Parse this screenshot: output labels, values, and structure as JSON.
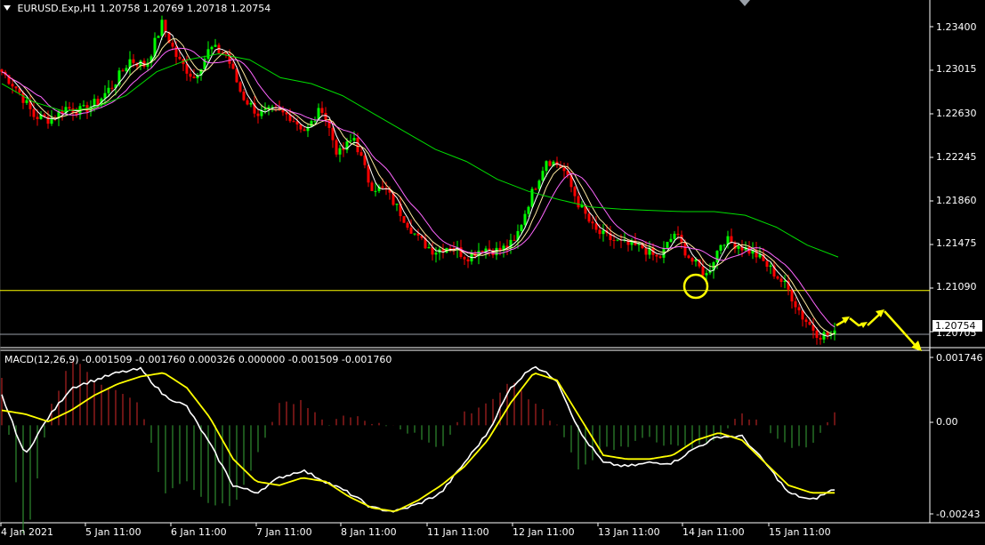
{
  "window": {
    "symbol_label": "EURUSD.Exp,H1",
    "ohlc_label": "1.20758 1.20769 1.20718 1.20754"
  },
  "price_axis": {
    "ticks": [
      "1.23400",
      "1.23015",
      "1.22630",
      "1.22245",
      "1.21860",
      "1.21475",
      "1.21090",
      "1.20705"
    ],
    "current_price": "1.20754"
  },
  "macd": {
    "label": "MACD(12,26,9) -0.001509 -0.001760 0.000326 0.000000 -0.001509 -0.001760",
    "ticks": [
      "0.001746",
      "0.00",
      "-0.00243"
    ]
  },
  "time_axis": {
    "ticks": [
      "4 Jan 2021",
      "5 Jan 11:00",
      "6 Jan 11:00",
      "7 Jan 11:00",
      "8 Jan 11:00",
      "11 Jan 11:00",
      "12 Jan 11:00",
      "13 Jan 11:00",
      "14 Jan 11:00",
      "15 Jan 11:00"
    ]
  },
  "colors": {
    "background": "#000000",
    "bull": "#00ff00",
    "bear": "#ff0000",
    "ma_fast": "#ffffff",
    "ma_mid": "#ffe9a0",
    "ma_purple": "#ff66ff",
    "ma_slow": "#00dd00",
    "hline": "#ffff00",
    "macd_main": "#ffffff",
    "macd_signal": "#ffff00",
    "hist_pos": "#b22222",
    "hist_neg": "#2e8b2e",
    "annotation": "#ffff00"
  },
  "chart_data": [
    {
      "type": "candlestick",
      "title": "EURUSD.Exp,H1",
      "ylim": [
        1.2065,
        1.2355
      ],
      "x": [
        "4 Jan 2021",
        "5 Jan 11:00",
        "6 Jan 11:00",
        "7 Jan 11:00",
        "8 Jan 11:00",
        "11 Jan 11:00",
        "12 Jan 11:00",
        "13 Jan 11:00",
        "14 Jan 11:00",
        "15 Jan 11:00"
      ],
      "close_path": [
        1.2295,
        1.228,
        1.2258,
        1.2255,
        1.2265,
        1.2262,
        1.227,
        1.2285,
        1.2305,
        1.23,
        1.2335,
        1.2305,
        1.229,
        1.2315,
        1.231,
        1.2275,
        1.226,
        1.2262,
        1.2258,
        1.2245,
        1.2265,
        1.2225,
        1.224,
        1.22,
        1.2195,
        1.2175,
        1.2155,
        1.2145,
        1.215,
        1.214,
        1.2148,
        1.2145,
        1.2152,
        1.219,
        1.2222,
        1.2215,
        1.2185,
        1.2162,
        1.2155,
        1.215,
        1.2148,
        1.2138,
        1.216,
        1.2138,
        1.2125,
        1.2155,
        1.215,
        1.2143,
        1.213,
        1.2115,
        1.209,
        1.2075,
        1.2075
      ],
      "horizontal_lines": [
        1.2112,
        1.20754
      ],
      "series": [
        {
          "values": [
            1.2285,
            1.227,
            1.2262,
            1.2265,
            1.2275,
            1.2295,
            1.2305,
            1.231,
            1.2305,
            1.229,
            1.2285,
            1.2275,
            1.226,
            1.2245,
            1.223,
            1.222,
            1.2205,
            1.2195,
            1.2188,
            1.2182,
            1.218,
            1.2179,
            1.2178,
            1.2178,
            1.2175,
            1.2165,
            1.215,
            1.214
          ]
        }
      ]
    },
    {
      "type": "bar",
      "title": "MACD(12,26,9)",
      "ylim": [
        -0.0026,
        0.002
      ],
      "main": [
        0.0008,
        -0.0008,
        0.0002,
        0.001,
        0.0012,
        0.0014,
        0.0015,
        0.0008,
        0.0005,
        -0.0005,
        -0.0016,
        -0.0018,
        -0.0014,
        -0.0012,
        -0.0015,
        -0.0018,
        -0.0022,
        -0.0023,
        -0.0021,
        -0.0018,
        -0.001,
        -0.0002,
        0.001,
        0.0016,
        0.0012,
        -0.0002,
        -0.001,
        -0.0011,
        -0.001,
        -0.001,
        -0.0006,
        -0.0003,
        -0.0003,
        -0.001,
        -0.0018,
        -0.002,
        -0.0017
      ],
      "signal": [
        0.0004,
        0.0003,
        0.0001,
        0.0004,
        0.0008,
        0.0011,
        0.0013,
        0.0014,
        0.001,
        0.0002,
        -0.0009,
        -0.0015,
        -0.0016,
        -0.0014,
        -0.0015,
        -0.0019,
        -0.0022,
        -0.0023,
        -0.002,
        -0.0016,
        -0.0011,
        -0.0004,
        0.0006,
        0.0014,
        0.0012,
        0.0002,
        -0.0008,
        -0.0009,
        -0.0009,
        -0.0008,
        -0.0004,
        -0.0002,
        -0.0004,
        -0.001,
        -0.0016,
        -0.0018,
        -0.0018
      ],
      "zero_line": 0
    }
  ]
}
